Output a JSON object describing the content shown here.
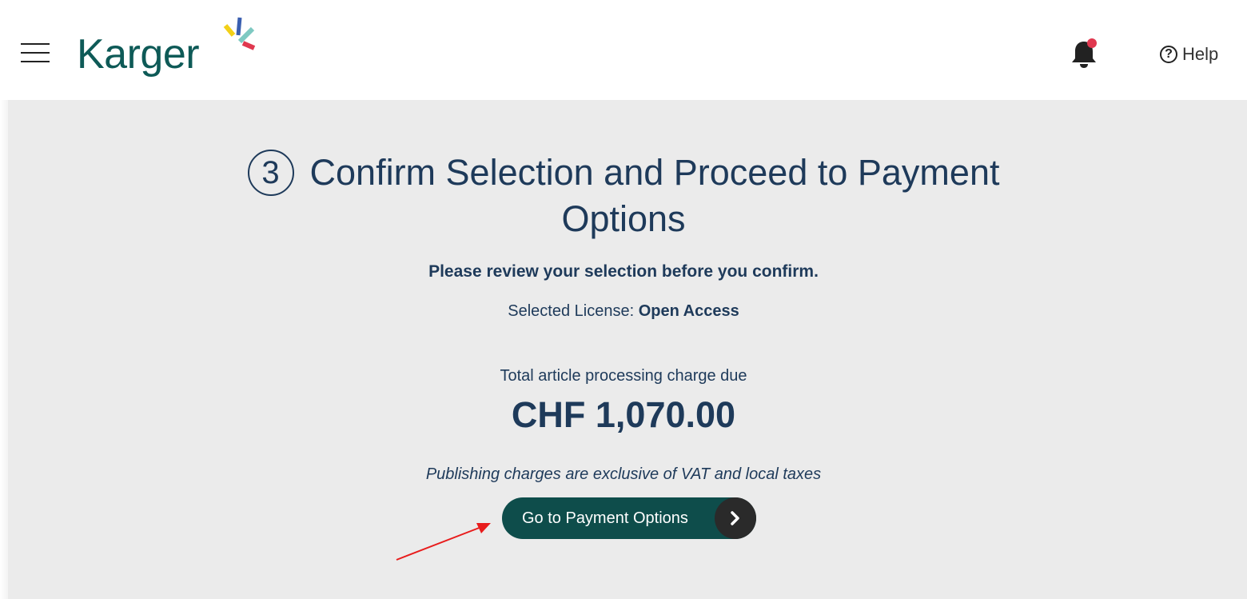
{
  "header": {
    "brand": "Karger",
    "help_label": "Help",
    "help_glyph": "?",
    "notification_dot_color": "#e0384f"
  },
  "main": {
    "step_number": "3",
    "title_line1": "Confirm Selection and Proceed to Payment",
    "title_line2": "Options",
    "review_text": "Please review your selection before you confirm.",
    "license_label": "Selected License:",
    "license_value": "Open Access",
    "total_label": "Total article processing charge due",
    "amount": "CHF 1,070.00",
    "vat_note": "Publishing charges are exclusive of VAT and local taxes",
    "button_label": "Go to Payment Options"
  },
  "colors": {
    "brand_teal": "#0e5a57",
    "button_bg": "#0e4d4b",
    "text_navy": "#1e3a5a",
    "annotation_red": "#e81c1c"
  },
  "icons": {
    "menu": "hamburger-icon",
    "notifications": "bell-icon",
    "help": "question-circle-icon",
    "button": "chevron-right-icon"
  }
}
